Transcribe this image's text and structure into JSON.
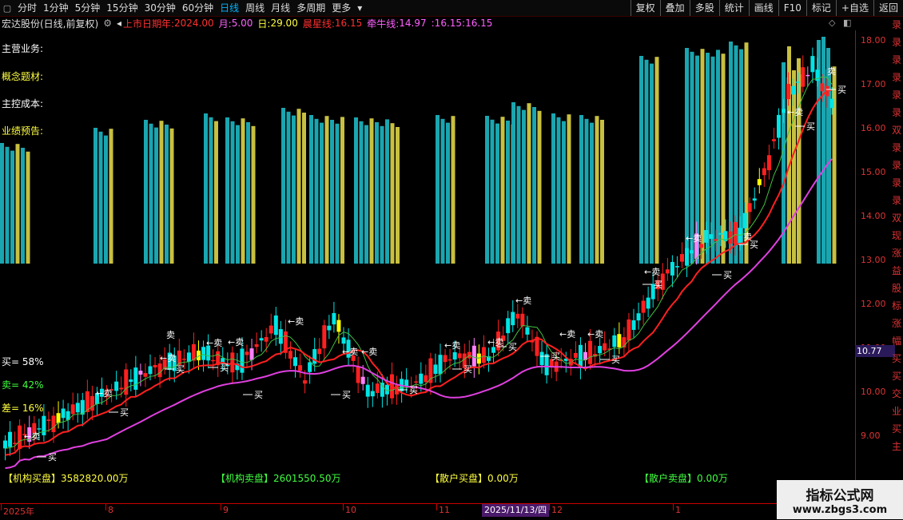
{
  "topbar": {
    "tabs": [
      {
        "label": "分时",
        "active": false
      },
      {
        "label": "1分钟",
        "active": false
      },
      {
        "label": "5分钟",
        "active": false
      },
      {
        "label": "15分钟",
        "active": false
      },
      {
        "label": "30分钟",
        "active": false
      },
      {
        "label": "60分钟",
        "active": false
      },
      {
        "label": "日线",
        "active": true
      },
      {
        "label": "周线",
        "active": false
      },
      {
        "label": "月线",
        "active": false
      },
      {
        "label": "多周期",
        "active": false
      },
      {
        "label": "更多",
        "active": false
      }
    ],
    "right_tabs": [
      "复权",
      "叠加",
      "多股",
      "统计",
      "画线",
      "F10",
      "标记",
      "+自选",
      "返回"
    ]
  },
  "infobar": {
    "title": "宏达股份(日线,前复权)",
    "listing_label": "上市日期年:",
    "listing_value": "2024.00",
    "month_label": "月:",
    "month_value": "5.00",
    "day_label": "日:",
    "day_value": "29.00",
    "star_label": "晨星线:",
    "star_value": "16.15",
    "niu_label": "牵牛线:",
    "niu_value": "14.97",
    "extra1": ":16.15",
    "extra2": ":16.15"
  },
  "side_labels": {
    "business": "主营业务:",
    "concept": "概念题材:",
    "cost": "主控成本:",
    "forecast": "业绩预告:",
    "buy_pct": "买= 58%",
    "sell_pct": "卖= 42%",
    "diff_pct": "差= 16%"
  },
  "bottom_stats": {
    "inst_buy": "【机构买盘】3582820.00万",
    "inst_sell": "【机构卖盘】2601550.50万",
    "retail_buy": "【散户买盘】0.00万",
    "retail_sell": "【散户卖盘】0.00万"
  },
  "axis": {
    "ticks": [
      "18.00",
      "17.00",
      "16.00",
      "15.00",
      "14.00",
      "13.00",
      "12.00",
      "11.00",
      "10.00",
      "9.00"
    ],
    "current_price": "10.77"
  },
  "xaxis": {
    "labels": [
      "2025年",
      "8",
      "9",
      "10",
      "11",
      "12",
      "1"
    ],
    "highlight": "2025/11/13/四"
  },
  "right_strip": [
    "录",
    "录",
    "录",
    "录",
    "录",
    "录",
    "双",
    "录",
    "录",
    "录",
    "录",
    "双",
    "现",
    "涨",
    "益",
    "股",
    "标",
    "涨",
    "幅",
    "买",
    "买",
    "交",
    "业",
    "买",
    "主"
  ],
  "watermark": {
    "line1": "指标公式网",
    "line2": "www.zbgs3.com"
  },
  "markers": {
    "buy": "买",
    "sell_arrow": "←卖",
    "sell": "卖"
  },
  "colors": {
    "up": "#ff2020",
    "down": "#00e5e5",
    "teal_bar": "#1aa6b0",
    "yellow_bar": "#c8c040",
    "ma_red": "#ff2020",
    "ma_magenta": "#e040e0",
    "pink": "#ff80ff",
    "yellow": "#ffff00"
  }
}
